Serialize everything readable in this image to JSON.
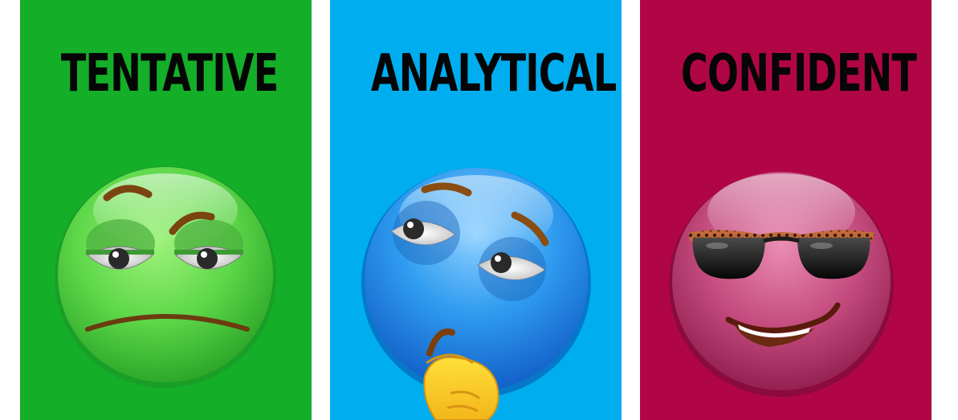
{
  "panels": [
    {
      "label": "TENTATIVE",
      "background": "#14ae29",
      "face_color": "#6fe05a",
      "icon": "skeptical-face-icon"
    },
    {
      "label": "ANALYTICAL",
      "background": "#00aeef",
      "face_color": "#2ea4f0",
      "icon": "thinking-face-icon"
    },
    {
      "label": "CONFIDENT",
      "background": "#b10645",
      "face_color": "#c9507f",
      "icon": "sunglasses-smirk-face-icon"
    }
  ]
}
